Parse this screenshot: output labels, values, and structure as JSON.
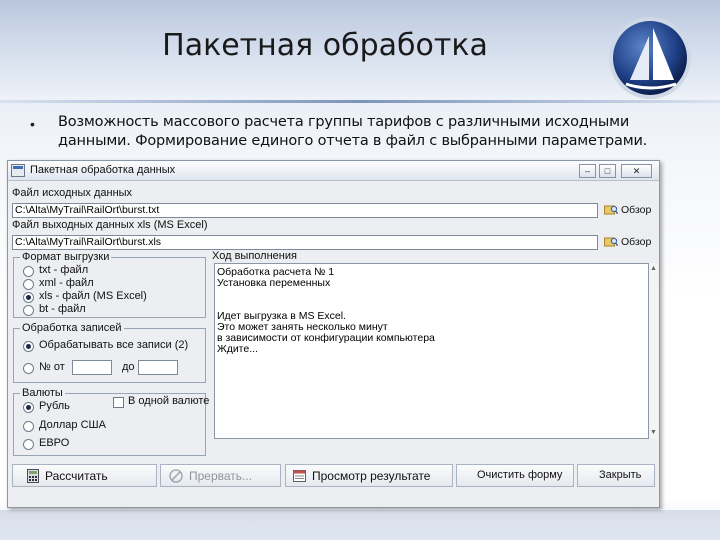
{
  "slide": {
    "title": "Пакетная обработка",
    "bullet_symbol": "•",
    "bullet_line1": "Возможность массового расчета группы тарифов с различными исходными",
    "bullet_line2": "данными. Формирование единого отчета в файл с выбранными параметрами."
  },
  "window": {
    "title": "Пакетная обработка данных",
    "min_label": "–",
    "max_label": "□",
    "close_label": "✕",
    "input_file": {
      "label": "Файл исходных данных",
      "value": "C:\\Alta\\MyTrail\\RailOrt\\burst.txt",
      "browse_label": "Обзор"
    },
    "output_file": {
      "label": "Файл выходных данных xls (MS Excel)",
      "value": "C:\\Alta\\MyTrail\\RailOrt\\burst.xls",
      "browse_label": "Обзор"
    },
    "format_group": {
      "title": "Формат выгрузки",
      "options": [
        "txt - файл",
        "xml - файл",
        "xls - файл (MS Excel)",
        "bt - файл"
      ],
      "selected_index": 2
    },
    "records_group": {
      "title": "Обработка записей",
      "option_all": "Обрабатывать все записи (2)",
      "option_from": "№ от",
      "to_label": "до",
      "selected": "all"
    },
    "currency_group": {
      "title": "Валюты",
      "options": [
        "Рубль",
        "Доллар США",
        "ЕВРО"
      ],
      "selected_index": 0,
      "single_currency_label": "В одной валюте",
      "single_currency_checked": false
    },
    "log": {
      "title": "Ход выполнения",
      "lines": [
        "Обработка расчета № 1",
        "Установка переменных",
        "",
        "",
        "Идет выгрузка в MS Excel.",
        "Это может занять несколько минут",
        "в зависимости от конфигурации компьютера",
        "Ждите..."
      ]
    },
    "buttons": {
      "calculate": "Рассчитать",
      "stop": "Прервать...",
      "view_result": "Просмотр результате",
      "clear_form": "Очистить форму",
      "close": "Закрыть"
    }
  }
}
